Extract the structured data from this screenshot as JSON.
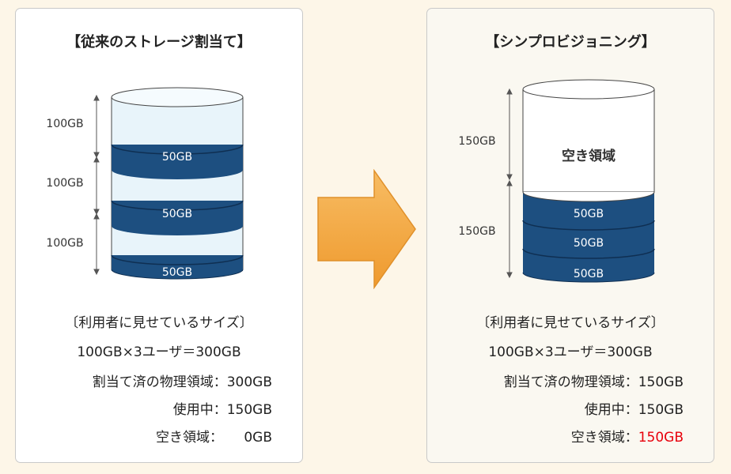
{
  "left": {
    "title": "【従来のストレージ割当て】",
    "size_labels": [
      "100GB",
      "100GB",
      "100GB"
    ],
    "segments": [
      "50GB",
      "50GB",
      "50GB"
    ],
    "caption": "〔利用者に見せているサイズ〕",
    "formula": "100GB×3ユーザ＝300GB",
    "stats": {
      "allocated_label": "割当て済の物理領域：",
      "allocated_value": "300GB",
      "used_label": "使用中：",
      "used_value": "150GB",
      "free_label": "空き領域：",
      "free_value": "0GB"
    }
  },
  "right": {
    "title": "【シンプロビジョニング】",
    "size_labels": [
      "150GB",
      "150GB"
    ],
    "free_area_label": "空き領域",
    "segments": [
      "50GB",
      "50GB",
      "50GB"
    ],
    "caption": "〔利用者に見せているサイズ〕",
    "formula": "100GB×3ユーザ＝300GB",
    "stats": {
      "allocated_label": "割当て済の物理領域：",
      "allocated_value": "150GB",
      "used_label": "使用中：",
      "used_value": "150GB",
      "free_label": "空き領域：",
      "free_value": "150GB"
    }
  },
  "colors": {
    "segment": "#1d4f80",
    "segment_edge": "#0f2f52",
    "light_band": "#e8f4fa",
    "arrow": "#f3a844",
    "free_value_highlight": "#e8000b"
  }
}
